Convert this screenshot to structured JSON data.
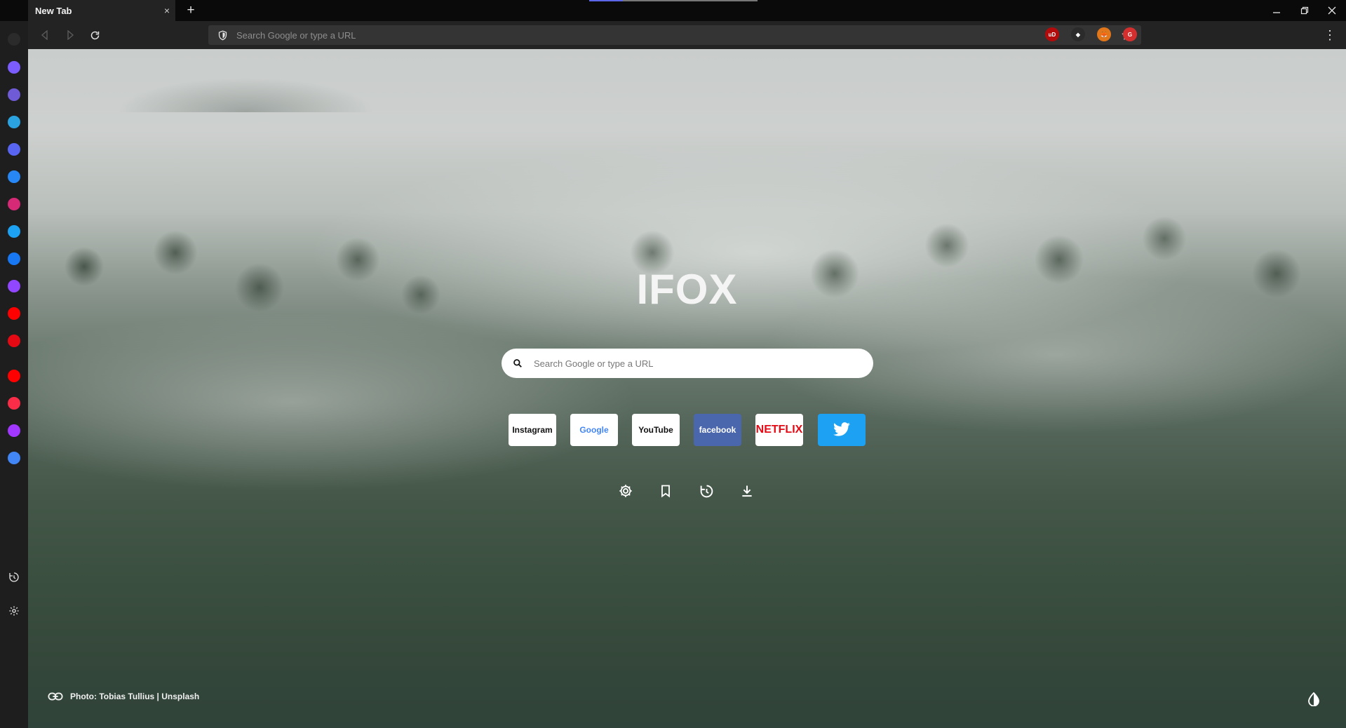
{
  "tab": {
    "title": "New Tab",
    "close_glyph": "×"
  },
  "new_tab": {
    "glyph": "+"
  },
  "toolbar": {
    "url_placeholder": "Search Google or type a URL",
    "extensions": [
      {
        "name": "ublock-origin-icon",
        "text": "uD",
        "color": "#b30b0b"
      },
      {
        "name": "binance-wallet-icon",
        "text": "◆",
        "color": "#2b2b2b"
      },
      {
        "name": "metamask-icon",
        "text": "🦊",
        "color": "#e2761b"
      },
      {
        "name": "red-extension-icon",
        "text": "G",
        "color": "#d32f2f"
      }
    ],
    "menu_glyph": "⋮"
  },
  "sidebar": {
    "items": [
      {
        "name": "ifox-logo-icon",
        "color": "#2b2b2b"
      },
      {
        "name": "messenger-icon",
        "color": "#7b5cff"
      },
      {
        "name": "whatsapp-globe-icon",
        "color": "#6f5bd6"
      },
      {
        "name": "telegram-icon",
        "color": "#2aa3e0"
      },
      {
        "name": "discord-icon",
        "color": "#5865f2"
      },
      {
        "name": "vk-icon",
        "color": "#2787f5"
      },
      {
        "name": "instagram-icon",
        "color": "#d62976"
      },
      {
        "name": "twitter-icon",
        "color": "#1da1f2"
      },
      {
        "name": "facebook-icon",
        "color": "#1877f2"
      },
      {
        "name": "twitch-icon",
        "color": "#9146ff"
      },
      {
        "name": "youtube-icon",
        "color": "#ff0000"
      },
      {
        "name": "netflix-icon",
        "color": "#e50914"
      },
      {
        "name": "youtube-music-icon",
        "color": "#ff0000"
      },
      {
        "name": "apple-music-icon",
        "color": "#fa2d48"
      },
      {
        "name": "deezer-icon",
        "color": "#a238ff"
      },
      {
        "name": "google-translate-icon",
        "color": "#4285f4"
      }
    ]
  },
  "main": {
    "title": "IFOX",
    "search_placeholder": "Search Google or type a URL",
    "tiles": [
      {
        "name": "tile-instagram",
        "label": "Instagram",
        "bg": "#ffffff",
        "color": "#111111"
      },
      {
        "name": "tile-google",
        "label": "Google",
        "bg": "#ffffff",
        "color": "#4285f4"
      },
      {
        "name": "tile-youtube",
        "label": "YouTube",
        "bg": "#ffffff",
        "color": "#111111"
      },
      {
        "name": "tile-facebook",
        "label": "facebook",
        "bg": "#4a67ad",
        "color": "#ffffff"
      },
      {
        "name": "tile-netflix",
        "label": "NETFLIX",
        "bg": "#ffffff",
        "color": "#e50914"
      },
      {
        "name": "tile-twitter",
        "label": "",
        "bg": "#1da1f2",
        "color": "#ffffff"
      }
    ],
    "credit": "Photo: Tobias Tullius | Unsplash"
  }
}
